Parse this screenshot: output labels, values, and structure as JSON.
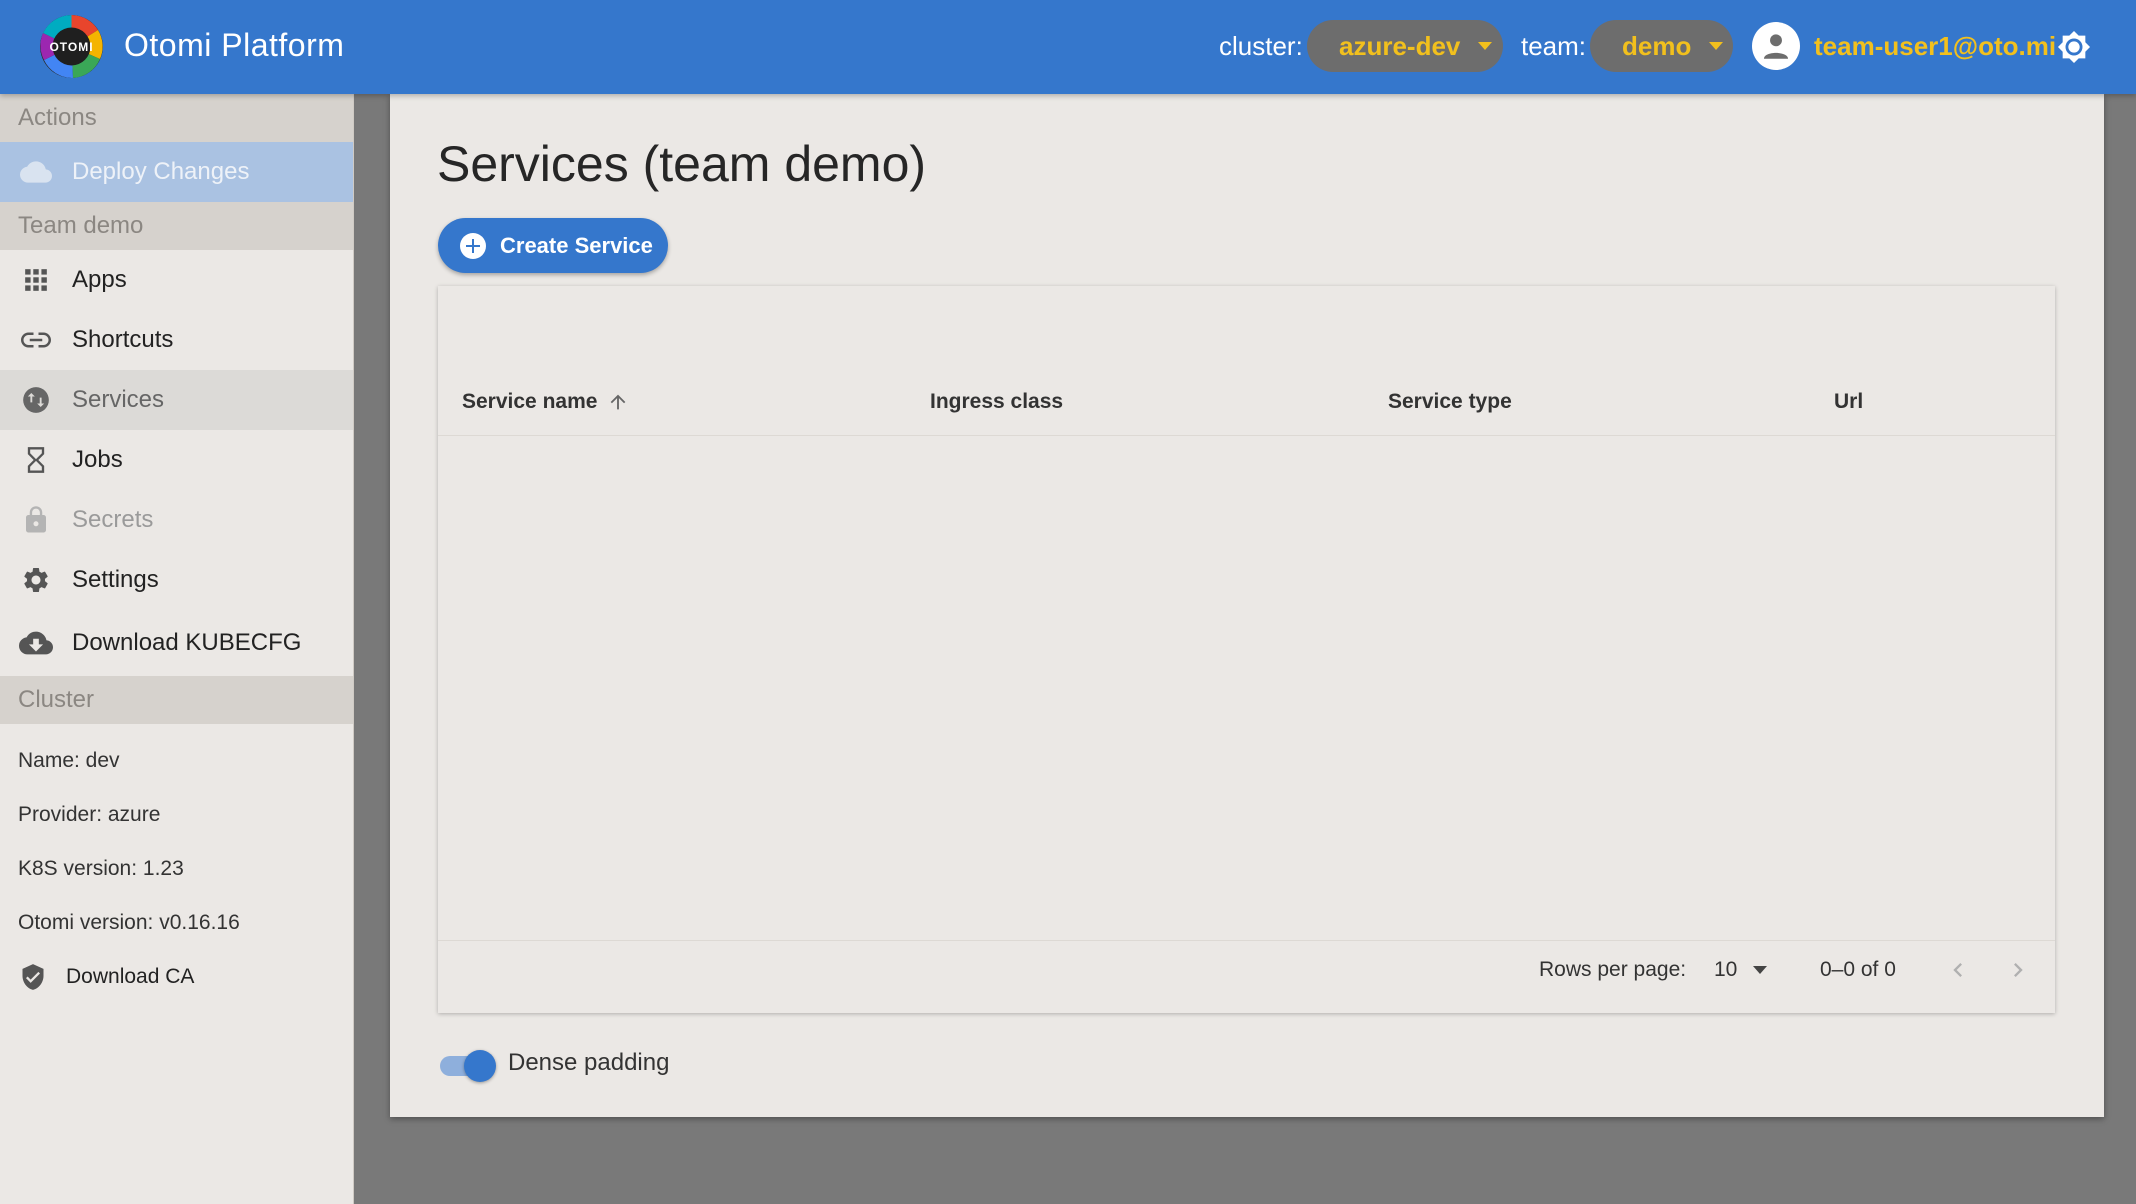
{
  "header": {
    "logo_text": "OTOMI",
    "app_title": "Otomi Platform",
    "cluster_label": "cluster:",
    "cluster_value": "azure-dev",
    "team_label": "team:",
    "team_value": "demo",
    "user_email": "team-user1@oto.mi",
    "accent_color": "#3577cc",
    "highlight_color": "#f2c01d"
  },
  "sidebar": {
    "actions_header": "Actions",
    "deploy_label": "Deploy Changes",
    "team_header": "Team demo",
    "items": [
      {
        "label": "Apps",
        "icon": "apps-grid-icon"
      },
      {
        "label": "Shortcuts",
        "icon": "link-icon"
      },
      {
        "label": "Services",
        "icon": "services-icon"
      },
      {
        "label": "Jobs",
        "icon": "hourglass-icon"
      },
      {
        "label": "Secrets",
        "icon": "lock-icon"
      },
      {
        "label": "Settings",
        "icon": "gear-icon"
      },
      {
        "label": "Download KUBECFG",
        "icon": "cloud-download-icon"
      }
    ],
    "cluster_header": "Cluster",
    "cluster_info": {
      "name": "Name: dev",
      "provider": "Provider: azure",
      "k8s": "K8S version: 1.23",
      "otomi": "Otomi version: v0.16.16"
    },
    "download_ca_label": "Download CA"
  },
  "main": {
    "title": "Services (team demo)",
    "create_button": "Create Service",
    "table": {
      "columns": [
        "Service name",
        "Ingress class",
        "Service type",
        "Url"
      ],
      "rows": [],
      "sort_column": "Service name",
      "sort_direction": "ascending"
    },
    "pagination": {
      "rows_per_page_label": "Rows per page:",
      "rows_per_page_value": "10",
      "range_text": "0–0 of 0"
    },
    "dense_padding_label": "Dense padding",
    "dense_padding_on": true
  }
}
